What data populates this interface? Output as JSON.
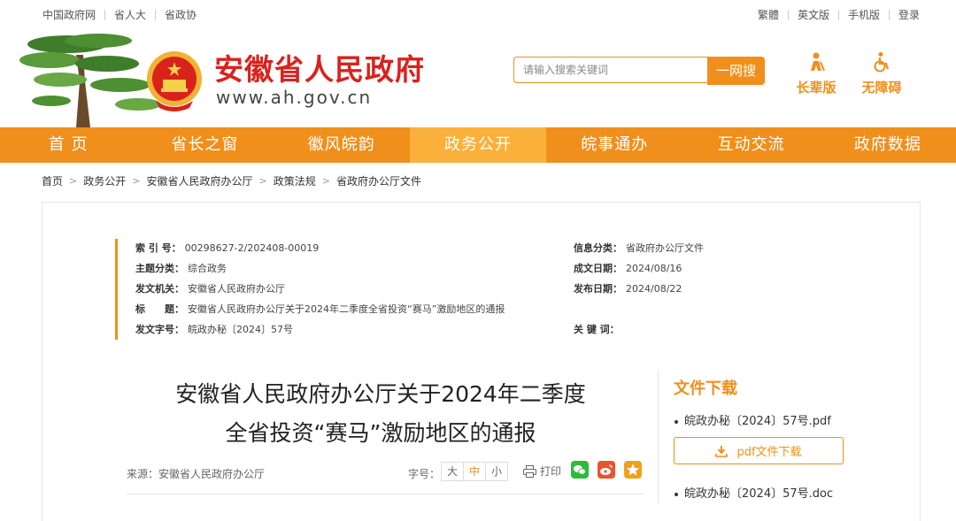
{
  "topbar": {
    "left": [
      "中国政府网",
      "省人大",
      "省政协"
    ],
    "right": [
      "繁體",
      "英文版",
      "手机版",
      "登录"
    ]
  },
  "header": {
    "site_name": "安徽省人民政府",
    "site_url": "www.ah.gov.cn",
    "search_placeholder": "请输入搜索关键词",
    "search_button": "一网搜",
    "tools": [
      {
        "label": "长辈版",
        "icon": "elder-icon"
      },
      {
        "label": "无障碍",
        "icon": "accessibility-icon"
      }
    ]
  },
  "nav": {
    "items": [
      "首 页",
      "省长之窗",
      "徽风皖韵",
      "政务公开",
      "皖事通办",
      "互动交流",
      "政府数据"
    ],
    "active_index": 3
  },
  "breadcrumb": [
    "首页",
    "政务公开",
    "安徽省人民政府办公厅",
    "政策法规",
    "省政府办公厅文件"
  ],
  "meta": {
    "index_label": "索 引 号：",
    "index_value": "00298627-2/202408-00019",
    "category_label": "信息分类：",
    "category_value": "省政府办公厅文件",
    "topic_label": "主题分类：",
    "topic_value": "综合政务",
    "created_label": "成文日期：",
    "created_value": "2024/08/16",
    "issuer_label": "发文机关：",
    "issuer_value": "安徽省人民政府办公厅",
    "published_label": "发布日期：",
    "published_value": "2024/08/22",
    "title_label": "标　　题：",
    "title_value": "安徽省人民政府办公厅关于2024年二季度全省投资“赛马”激励地区的通报",
    "docno_label": "发文字号：",
    "docno_value": "皖政办秘〔2024〕57号",
    "keywords_label": "关 键 词："
  },
  "document": {
    "title_line1": "安徽省人民政府办公厅关于2024年二季度",
    "title_line2": "全省投资“赛马”激励地区的通报",
    "source": "来源：安徽省人民政府办公厅",
    "font_size_label": "字号：",
    "font_sizes": [
      "大",
      "中",
      "小"
    ],
    "font_size_active": "中",
    "print_label": "打印"
  },
  "downloads": {
    "title": "文件下载",
    "file1": "皖政办秘〔2024〕57号.pdf",
    "button": "pdf文件下载",
    "file2": "皖政办秘〔2024〕57号.doc"
  },
  "colors": {
    "brand": "#f08f1b",
    "title_red": "#d9221c",
    "nav_active": "#fbb03b",
    "wechat": "#2dbb3c",
    "weibo": "#e9532d",
    "favorite": "#f0a11b"
  }
}
